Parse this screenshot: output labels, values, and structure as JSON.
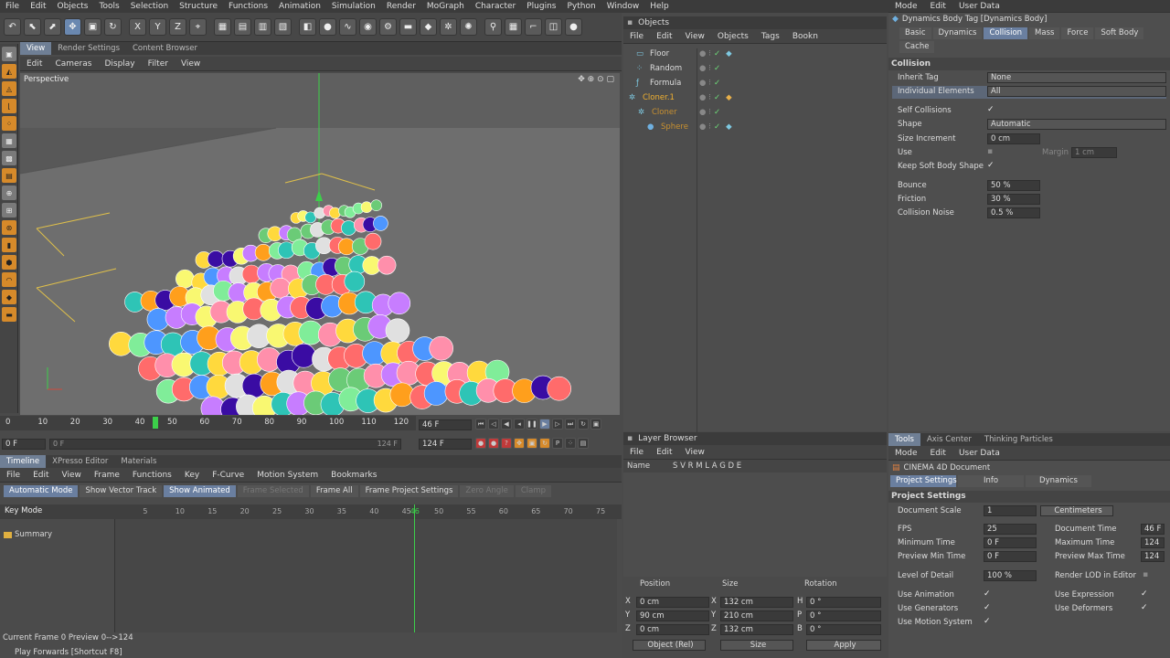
{
  "menu": [
    "File",
    "Edit",
    "Objects",
    "Tools",
    "Selection",
    "Structure",
    "Functions",
    "Animation",
    "Simulation",
    "Render",
    "MoGraph",
    "Character",
    "Plugins",
    "Python",
    "Window",
    "Help"
  ],
  "viewport_tabs": [
    "View",
    "Render Settings",
    "Content Browser"
  ],
  "viewport_menu": [
    "Edit",
    "Cameras",
    "Display",
    "Filter",
    "View"
  ],
  "viewport_label": "Perspective",
  "ruler_ticks": [
    "0",
    "10",
    "20",
    "30",
    "40",
    "50",
    "60",
    "70",
    "80",
    "90",
    "100",
    "110",
    "120"
  ],
  "playback": {
    "current_frame_field": "46 F",
    "start_frame": "0 F",
    "start_frame2": "0 F",
    "end_frame": "124 F",
    "end_frame2": "124 F"
  },
  "timeline": {
    "tabs": [
      "Timeline",
      "XPresso Editor",
      "Materials"
    ],
    "menu": [
      "File",
      "Edit",
      "View",
      "Frame",
      "Functions",
      "Key",
      "F-Curve",
      "Motion System",
      "Bookmarks"
    ],
    "buttons": [
      "Automatic Mode",
      "Show Vector Track",
      "Show Animated",
      "Frame Selected",
      "Frame All",
      "Frame Project Settings",
      "Zero Angle",
      "Clamp"
    ],
    "mode_label": "Key Mode",
    "ticks": [
      "5",
      "10",
      "15",
      "20",
      "25",
      "30",
      "35",
      "40",
      "45",
      "46",
      "50",
      "55",
      "60",
      "65",
      "70",
      "75"
    ],
    "summary": "Summary",
    "status": "Current Frame  0  Preview  0-->124",
    "hint": "Play Forwards [Shortcut F8]"
  },
  "objects": {
    "title": "Objects",
    "menu": [
      "File",
      "Edit",
      "View",
      "Objects",
      "Tags",
      "Bookn"
    ],
    "items": [
      {
        "name": "Floor",
        "color": "#dddddd"
      },
      {
        "name": "Random",
        "color": "#dddddd"
      },
      {
        "name": "Formula",
        "color": "#dddddd"
      },
      {
        "name": "Cloner.1",
        "color": "#f0b030"
      },
      {
        "name": "Cloner",
        "color": "#c89030"
      },
      {
        "name": "Sphere",
        "color": "#c89030"
      }
    ]
  },
  "layer_browser": {
    "title": "Layer Browser",
    "menu": [
      "File",
      "Edit",
      "View"
    ],
    "cols": "Name",
    "flags": "S V R M L A G D E"
  },
  "coords": {
    "headers": [
      "Position",
      "Size",
      "Rotation"
    ],
    "rows": [
      {
        "a": "X",
        "pv": "0 cm",
        "b": "X",
        "sv": "132 cm",
        "c": "H",
        "rv": "0 °"
      },
      {
        "a": "Y",
        "pv": "90 cm",
        "b": "Y",
        "sv": "210 cm",
        "c": "P",
        "rv": "0 °"
      },
      {
        "a": "Z",
        "pv": "0 cm",
        "b": "Z",
        "sv": "132 cm",
        "c": "B",
        "rv": "0 °"
      }
    ],
    "mode": "Object (Rel)",
    "size_mode": "Size",
    "apply": "Apply"
  },
  "attributes": {
    "menu": [
      "Mode",
      "Edit",
      "User Data"
    ],
    "title": "Dynamics Body Tag [Dynamics Body]",
    "tabs": [
      "Basic",
      "Dynamics",
      "Collision",
      "Mass",
      "Force",
      "Soft Body"
    ],
    "tab2": "Cache",
    "section": "Collision",
    "inherit_tag_label": "Inherit Tag",
    "inherit_tag": "None",
    "individual_label": "Individual Elements",
    "individual": "All",
    "self_coll_label": "Self Collisions",
    "shape_label": "Shape",
    "shape": "Automatic",
    "size_inc_label": "Size Increment",
    "size_inc": "0 cm",
    "use_label": "Use",
    "margin_label": "Margin",
    "margin": "1 cm",
    "keep_label": "Keep Soft Body Shape",
    "bounce_label": "Bounce",
    "bounce": "50 %",
    "friction_label": "Friction",
    "friction": "30 %",
    "noise_label": "Collision Noise",
    "noise": "0.5 %"
  },
  "tools": {
    "tabs": [
      "Tools",
      "Axis Center",
      "Thinking Particles"
    ],
    "menu": [
      "Mode",
      "Edit",
      "User Data"
    ],
    "doc": "CINEMA 4D Document",
    "subtabs": [
      "Project Settings",
      "Info",
      "Dynamics"
    ],
    "section": "Project Settings",
    "scale_label": "Document Scale",
    "scale": "1",
    "units": "Centimeters",
    "fps_label": "FPS",
    "fps": "25",
    "doc_time_label": "Document Time",
    "doc_time": "46 F",
    "min_time_label": "Minimum Time",
    "min_time": "0 F",
    "max_time_label": "Maximum Time",
    "max_time": "124",
    "pmin_label": "Preview Min Time",
    "pmin": "0 F",
    "pmax_label": "Preview Max Time",
    "pmax": "124",
    "lod_label": "Level of Detail",
    "lod": "100 %",
    "rlod_label": "Render LOD in Editor",
    "use_anim": "Use Animation",
    "use_expr": "Use Expression",
    "use_gen": "Use Generators",
    "use_def": "Use Deformers",
    "use_motion": "Use Motion System"
  }
}
